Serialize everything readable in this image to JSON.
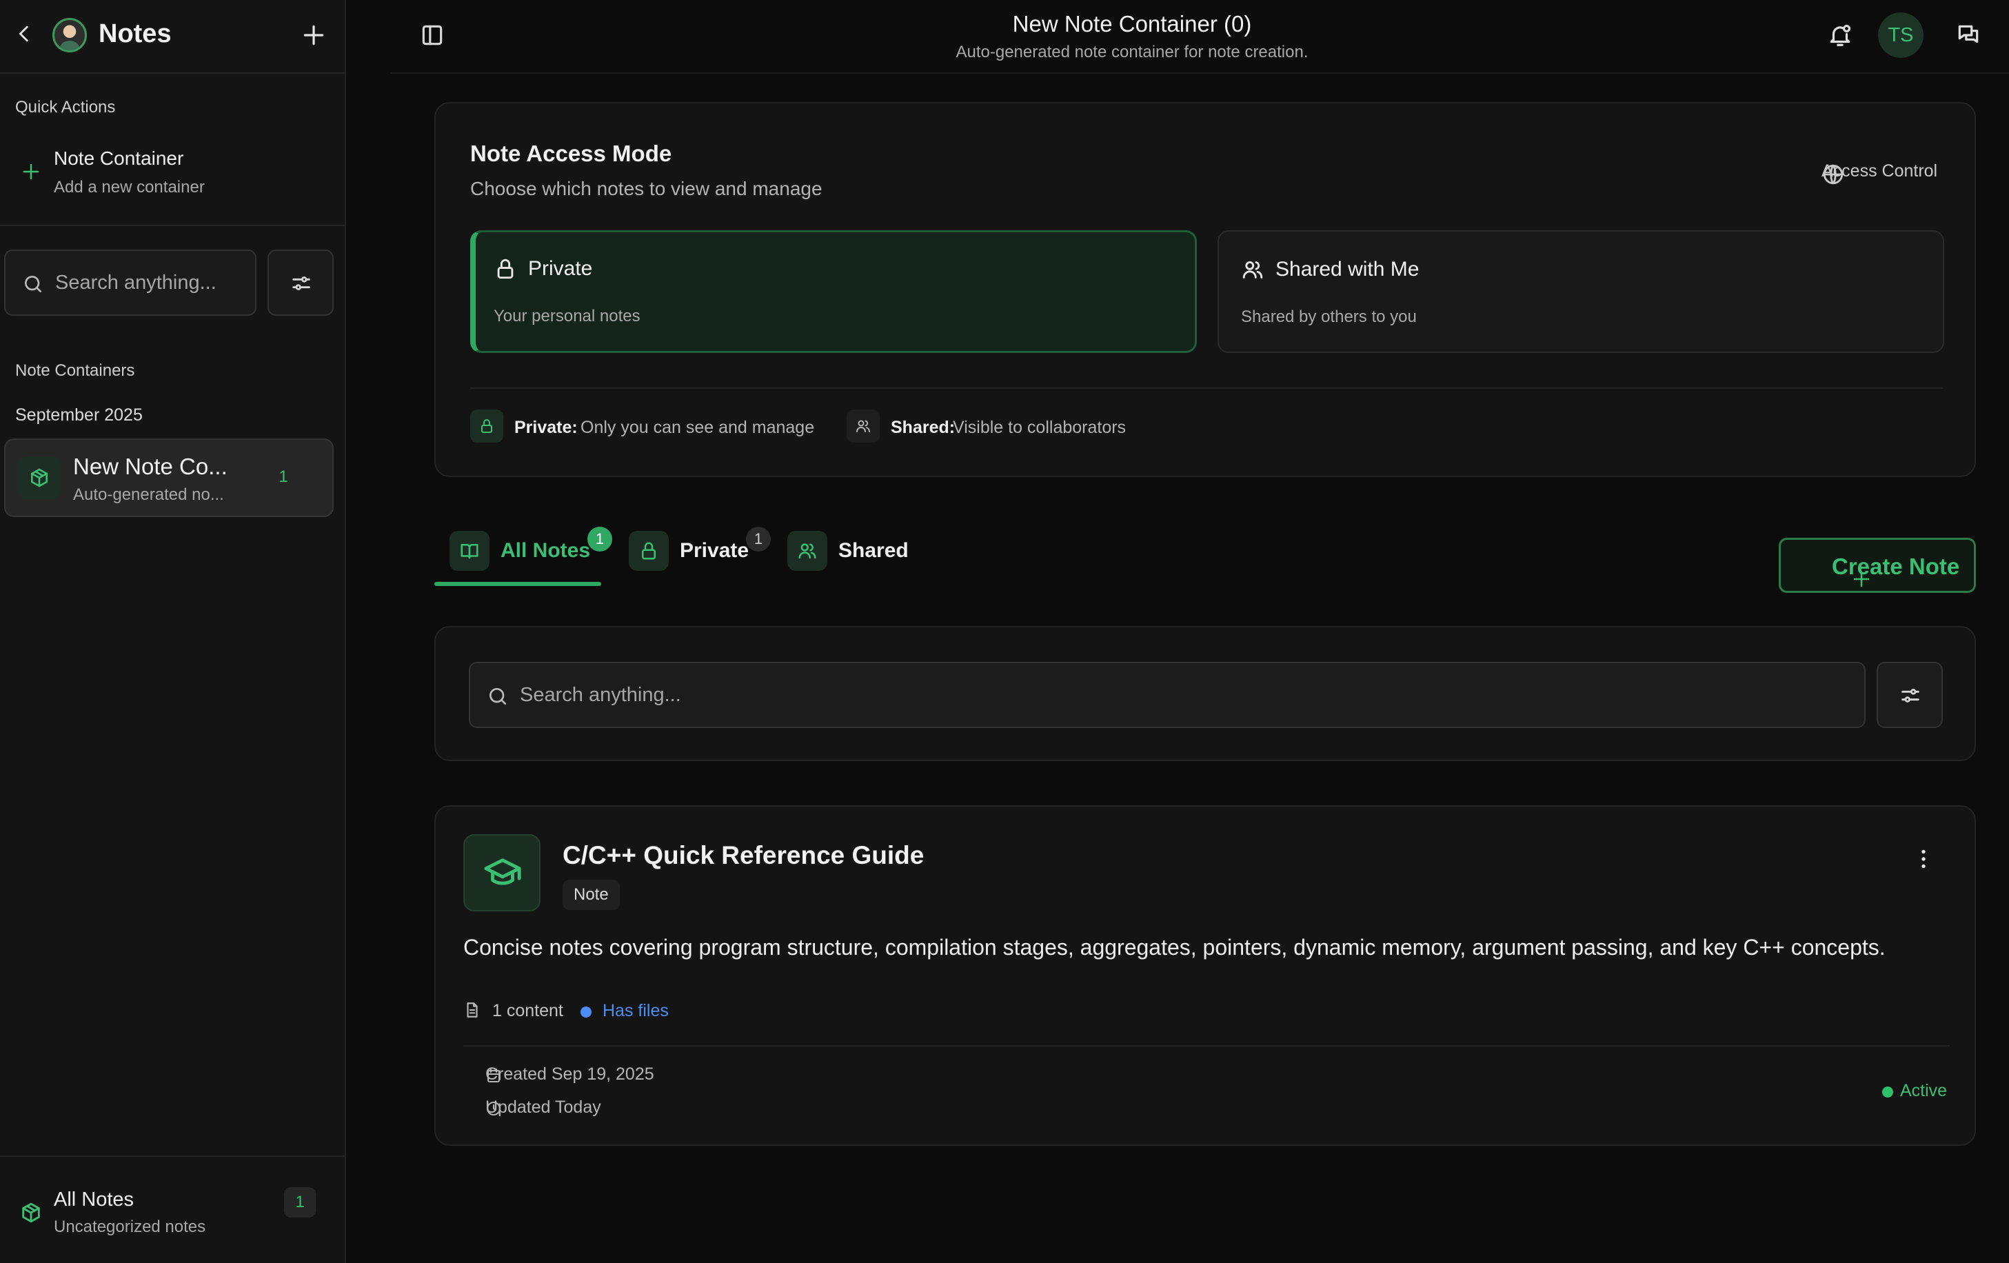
{
  "sidebar": {
    "title": "Notes",
    "quick_actions_label": "Quick Actions",
    "quick_action": {
      "title": "Note Container",
      "subtitle": "Add a new container"
    },
    "search_placeholder": "Search anything...",
    "containers_label": "Note Containers",
    "month_label": "September 2025",
    "container_item": {
      "title": "New Note Co...",
      "subtitle": "Auto-generated no...",
      "count": "1"
    },
    "all_notes": {
      "title": "All Notes",
      "subtitle": "Uncategorized notes",
      "count": "1"
    }
  },
  "topbar": {
    "title": "New Note Container (0)",
    "subtitle": "Auto-generated note container for note creation.",
    "user_initials": "TS"
  },
  "access": {
    "title": "Note Access Mode",
    "subtitle": "Choose which notes to view and manage",
    "control_label": "Access Control",
    "private": {
      "title": "Private",
      "subtitle": "Your personal notes"
    },
    "shared": {
      "title": "Shared with Me",
      "subtitle": "Shared by others to you"
    },
    "legend": {
      "private_key": "Private:",
      "private_value": "Only you can see and manage",
      "shared_key": "Shared:",
      "shared_value": "Visible to collaborators"
    }
  },
  "tabs": [
    {
      "label": "All Notes",
      "badge": "1"
    },
    {
      "label": "Private",
      "badge": "1"
    },
    {
      "label": "Shared"
    }
  ],
  "create_note_label": "Create Note",
  "main_search_placeholder": "Search anything...",
  "note": {
    "title": "C/C++ Quick Reference Guide",
    "tag": "Note",
    "description": "Concise notes covering program structure, compilation stages, aggregates, pointers, dynamic memory, argument passing, and key C++ concepts.",
    "content_count": "1 content",
    "files_label": "Has files",
    "created": "Created Sep 19, 2025",
    "updated": "Updated Today",
    "status": "Active"
  },
  "colors": {
    "accent": "#2ea862",
    "accent_text": "#3bbf73",
    "files_blue": "#4b8df5",
    "background": "#0c0c0c",
    "card": "#141414"
  },
  "icons": {
    "back": "chevron-left-icon",
    "add": "plus-icon",
    "search": "search-icon",
    "filter": "sliders-icon",
    "container": "box-icon",
    "panel": "sidebar-toggle-icon",
    "notifications": "bell-icon",
    "messages": "chat-icon",
    "access": "globe-icon",
    "private": "lock-icon",
    "shared": "users-icon",
    "all_notes": "book-open-icon",
    "note": "graduation-cap-icon",
    "more": "more-vertical-icon",
    "file": "file-icon",
    "calendar": "calendar-icon",
    "clock": "clock-icon"
  }
}
